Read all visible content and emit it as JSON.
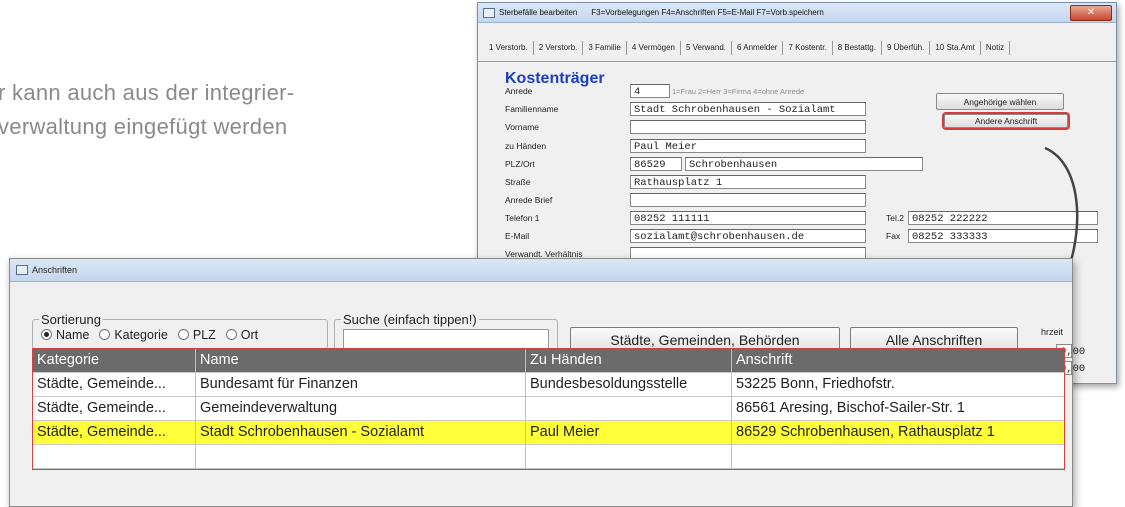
{
  "intro": {
    "line1": "r kann auch aus der integrier-",
    "line2": "verwaltung eingefügt werden"
  },
  "window1": {
    "title": "Sterbefälle bearbeiten",
    "keys": "F3=Vorbelegungen F4=Anschriften F5=E-Mail F7=Vorb.speichern",
    "close": "✕",
    "tabs": [
      "1 Verstorb.",
      "2 Verstorb.",
      "3 Familie",
      "4 Vermögen",
      "5 Verwand.",
      "6 Anmelder",
      "7 Kostentr.",
      "8 Bestattg.",
      "9 Überfüh.",
      "10 Sta.Amt",
      "Notiz"
    ],
    "heading": "Kostenträger",
    "labels": {
      "anrede": "Anrede",
      "familienname": "Familienname",
      "vorname": "Vorname",
      "zu_haenden": "zu Händen",
      "plz_ort": "PLZ/Ort",
      "strasse": "Straße",
      "anrede_brief": "Anrede Brief",
      "telefon1": "Telefon 1",
      "email": "E-Mail",
      "verwandt": "Verwandt. Verhältnis",
      "tel2": "Tel.2",
      "fax": "Fax"
    },
    "values": {
      "anrede": "4",
      "familienname": "Stadt Schrobenhausen - Sozialamt",
      "vorname": "",
      "zu_haenden": "Paul Meier",
      "plz": "86529",
      "ort": "Schrobenhausen",
      "strasse": "Rathausplatz 1",
      "anrede_brief": "",
      "telefon1": "08252 111111",
      "email": "sozialamt@schrobenhausen.de",
      "verwandt": "",
      "tel2": "08252 222222",
      "fax": "08252 333333"
    },
    "anrede_hint": "1=Frau   2=Herr   3=Firma   4=ohne Anrede",
    "buttons": {
      "angehoerige": "Angehörige wählen",
      "andere": "Andere Anschrift"
    }
  },
  "window2": {
    "title": "Anschriften",
    "sortierung_label": "Sortierung",
    "radios": [
      "Name",
      "Kategorie",
      "PLZ",
      "Ort"
    ],
    "selected_radio": "Name",
    "suche_label": "Suche (einfach tippen!)",
    "suche_value": "",
    "btn_staedte": "Städte, Gemeinden, Behörden",
    "btn_alle": "Alle Anschriften",
    "side_label": "hrzeit",
    "side_values": [
      "0,00",
      "0,00"
    ],
    "columns": [
      "Kategorie",
      "Name",
      "Zu Händen",
      "Anschrift"
    ],
    "rows": [
      [
        "Städte, Gemeinde...",
        "Bundesamt für Finanzen",
        "Bundesbesoldungsstelle",
        "53225 Bonn, Friedhofstr."
      ],
      [
        "Städte, Gemeinde...",
        "Gemeindeverwaltung",
        "",
        "86561 Aresing, Bischof-Sailer-Str. 1"
      ],
      [
        "Städte, Gemeinde...",
        "Stadt Schrobenhausen - Sozialamt",
        "Paul Meier",
        "86529 Schrobenhausen, Rathausplatz 1"
      ],
      [
        "",
        "",
        "",
        ""
      ]
    ],
    "selected_row": 2
  },
  "colors": {
    "heading_blue": "#1a3fbf",
    "highlight_red": "#d93a3a",
    "selected_row": "#ffff3a",
    "grid_header": "#6b6b6b"
  }
}
